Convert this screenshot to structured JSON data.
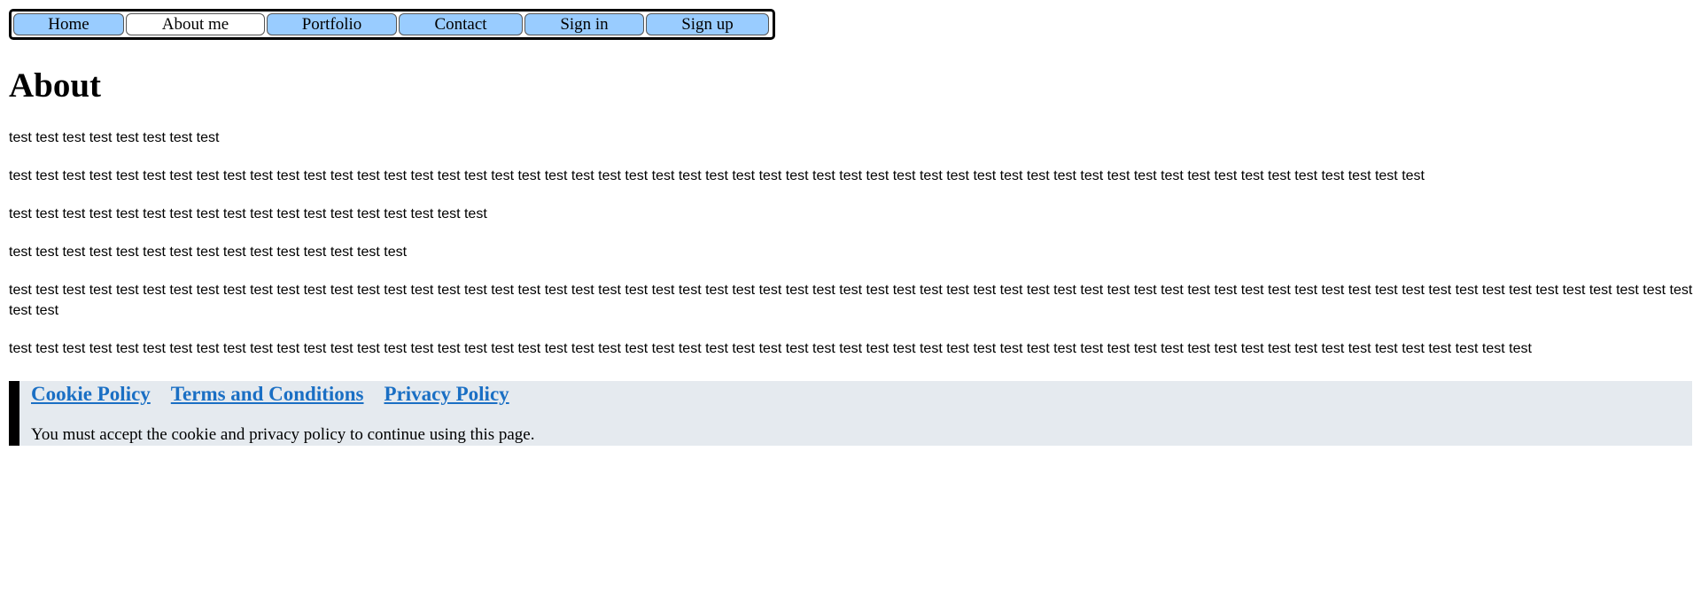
{
  "nav": {
    "items": [
      {
        "label": "Home",
        "active": false
      },
      {
        "label": "About me",
        "active": true
      },
      {
        "label": "Portfolio",
        "active": false
      },
      {
        "label": "Contact",
        "active": false
      },
      {
        "label": "Sign in",
        "active": false
      },
      {
        "label": "Sign up",
        "active": false
      }
    ]
  },
  "main": {
    "title": "About",
    "paragraphs": [
      "test test test test test test test test",
      "test test test test test test test test test test test test test test test test test test test test test test test test test test test test test test test test test test test test test test test test test test test test test test test test test test test test test",
      "test test test test test test test test test test test test test test test test test test",
      "test test test test test test test test test test test test test test test",
      "test test test test test test test test test test test test test test test test test test test test test test test test test test test test test test test test test test test test test test test test test test test test test test test test test test test test test test test test test test test test test test test test test",
      "test test test test test test test test test test test test test test test test test test test test test test test test test test test test test test test test test test test test test test test test test test test test test test test test test test test test test test test test test"
    ]
  },
  "footer": {
    "links": [
      "Cookie Policy",
      "Terms and Conditions",
      "Privacy Policy"
    ],
    "notice": "You must accept the cookie and privacy policy to continue using this page."
  }
}
